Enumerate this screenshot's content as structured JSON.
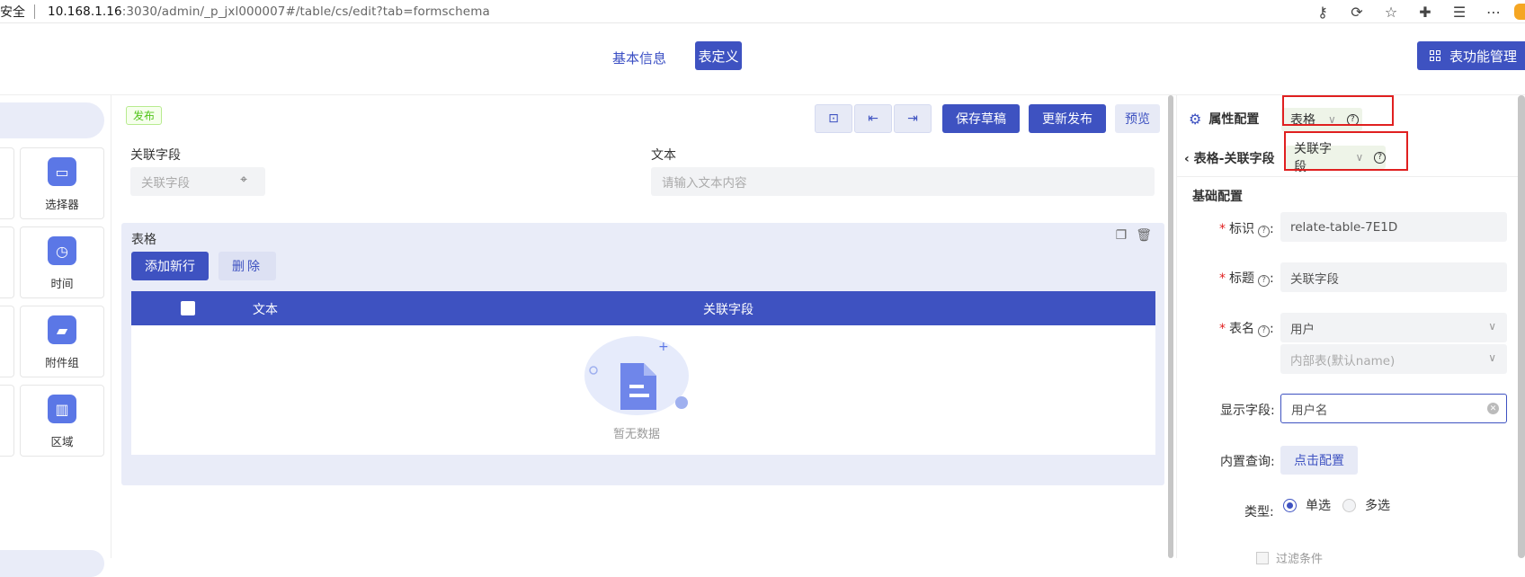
{
  "browser": {
    "security": "安全",
    "url_host": "10.168.1.16",
    "url_rest": ":3030/admin/_p_jxl000007#/table/cs/edit?tab=formschema"
  },
  "topnav": {
    "tab_basic": "基本信息",
    "tab_definition": "表定义",
    "manage_button": "表功能管理"
  },
  "components": [
    {
      "label": "选择器",
      "icon": "selector-icon"
    },
    {
      "label": "时间",
      "icon": "clock-icon"
    },
    {
      "label": "附件组",
      "icon": "folder-icon"
    },
    {
      "label": "区域",
      "icon": "map-icon"
    }
  ],
  "form": {
    "status_badge": "发布",
    "toolbar": {
      "save_draft": "保存草稿",
      "update_publish": "更新发布",
      "preview": "预览"
    },
    "field1_label": "关联字段",
    "field1_placeholder": "关联字段",
    "field2_label": "文本",
    "field2_placeholder": "请输入文本内容",
    "table": {
      "title": "表格",
      "add_row": "添加新行",
      "delete": "删除",
      "columns": [
        "文本",
        "关联字段"
      ],
      "empty_text": "暂无数据"
    }
  },
  "props": {
    "header": "属性配置",
    "selected_component": "表格",
    "breadcrumb": "表格-关联字段",
    "selected_field": "关联字段",
    "section": "基础配置",
    "id_label": "标识",
    "id_value": "relate-table-7E1D",
    "title_label": "标题",
    "title_value": "关联字段",
    "table_label": "表名",
    "table_value": "用户",
    "table_sub_placeholder": "内部表(默认name)",
    "display_label": "显示字段:",
    "display_value": "用户名",
    "query_label": "内置查询:",
    "query_button": "点击配置",
    "type_label": "类型:",
    "type_single": "单选",
    "type_multi": "多选",
    "cut_text": "过滤条件"
  }
}
